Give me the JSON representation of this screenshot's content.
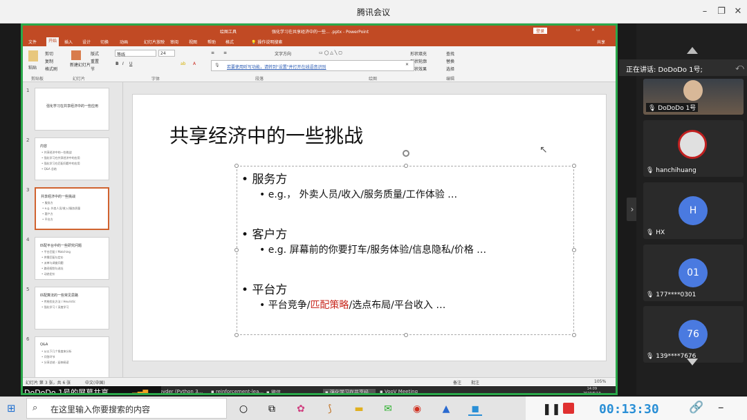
{
  "app": {
    "title": "腾讯会议"
  },
  "ppt": {
    "file_title": "强化学习在共享经济中的一些... .pptx - PowerPoint",
    "tool_label": "绘图工具",
    "signin": "登录",
    "share": "共享",
    "tabs": [
      "文件",
      "开始",
      "插入",
      "设计",
      "切换",
      "动画",
      "幻灯片放映",
      "审阅",
      "视图",
      "帮助",
      "格式"
    ],
    "search_hint": "操作说明搜索",
    "ribbon": {
      "paste": "粘贴",
      "cut": "剪切",
      "copy": "复制",
      "format_painter": "格式刷",
      "new_slide": "新建幻灯片",
      "layout": "版式",
      "reset": "重置",
      "section": "节",
      "font": "等线",
      "font_size": "24",
      "text_direction": "文字方向",
      "shape_fill": "形状填充",
      "shape_outline": "形状轮廓",
      "shape_effect": "形状效果",
      "find": "查找",
      "replace": "替换",
      "select": "选择",
      "groups": [
        "剪贴板",
        "幻灯片",
        "字体",
        "段落",
        "绘图",
        "编辑"
      ]
    },
    "notice": "若要使用听写功能，请转到\"设置\"并打开在线语音识别",
    "status": {
      "slide_num": "幻灯片 第 3 张，共 6 张",
      "lang": "中文(中国)",
      "notes": "备注",
      "comments": "批注",
      "zoom": "105%"
    },
    "thumbs": [
      {
        "num": "1",
        "title": "强化学习在共享经济中的一些应用",
        "lines": []
      },
      {
        "num": "2",
        "title": "内容",
        "lines": [
          "共享经济中的一些挑战",
          "强化学习在共享经济中的应用",
          "强化学习在匹配问题中的应用",
          "Q&A 总结"
        ]
      },
      {
        "num": "3",
        "title": "共享经济中的一些挑战",
        "lines": [
          "服务方",
          "e.g. 外卖人员/收入/服务质量",
          "客户方",
          "平台方"
        ]
      },
      {
        "num": "4",
        "title": "匹配平台中的一些研究问题",
        "lines": [
          "平台匹配 / Matching",
          "供需匹配与定价",
          "派单与调度问题",
          "路径规划与选址",
          "动态定价"
        ]
      },
      {
        "num": "5",
        "title": "匹配算法的一些常见思路",
        "lines": [
          "传统优化方法 / Heuristic",
          "强化学习 / 深度学习"
        ]
      },
      {
        "num": "6",
        "title": "Q&A",
        "lines": [
          "从以下几个角度来分析",
          "问答环节",
          "分享总结 · 延伸阅读"
        ]
      }
    ]
  },
  "slide": {
    "title": "共享经济中的一些挑战",
    "sections": [
      {
        "heading": "服务方",
        "detail": "e.g.， 外卖人员/收入/服务质量/工作体验 …"
      },
      {
        "heading": "客户方",
        "detail": "e.g. 屏幕前的你要打车/服务体验/信息隐私/价格 …"
      },
      {
        "heading": "平台方",
        "detail_pre": "平台竞争/",
        "detail_red": "匹配策略",
        "detail_post": "/选点布局/平台收入 …"
      }
    ]
  },
  "meeting": {
    "speaking": "正在讲话: DoDoDo 1号;",
    "banner": "DoDoDo 1号的屏幕共享",
    "timer": "00:13:30",
    "participants": [
      {
        "name": "DoDoDo 1号",
        "avatar": "video"
      },
      {
        "name": "hanchihuang",
        "avatar": "photo"
      },
      {
        "name": "HX",
        "avatar": "H"
      },
      {
        "name": "177****0301",
        "avatar": "01"
      },
      {
        "name": "139****7676",
        "avatar": "76"
      }
    ]
  },
  "inner_taskbar": {
    "apps": [
      "Spyder (Python 3...",
      "reinforcement-lea...",
      "微信",
      "强化学习在共享经...",
      "VooV Meeting"
    ],
    "time": "14:09",
    "date": "2020/5/19"
  },
  "taskbar": {
    "search_placeholder": "在这里输入你要搜索的内容"
  },
  "colors": {
    "ppt_ribbon": "#c14a24",
    "share_border": "#2aa84a",
    "accent_red": "#c8281e",
    "timer": "#2a8fd6"
  }
}
